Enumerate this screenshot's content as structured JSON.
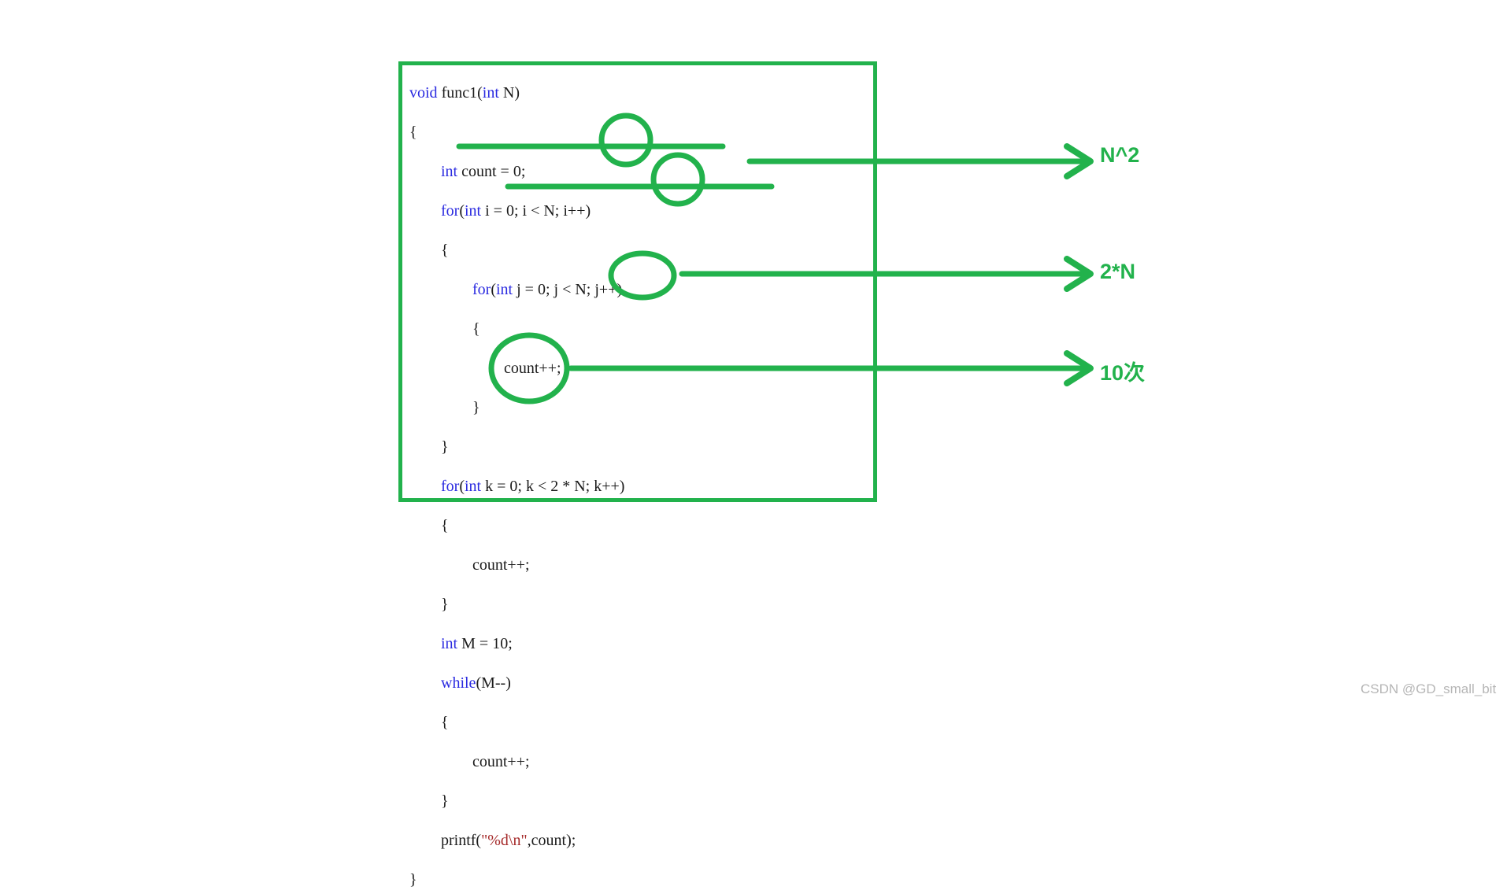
{
  "code": {
    "language": "c",
    "function_name": "func1",
    "lines": [
      [
        {
          "t": "void ",
          "c": "kw"
        },
        {
          "t": "func1(",
          "c": "pl"
        },
        {
          "t": "int",
          "c": "kw"
        },
        {
          "t": " N)",
          "c": "pl"
        }
      ],
      [
        {
          "t": "{",
          "c": "pl"
        }
      ],
      [
        {
          "t": "        ",
          "c": "pl"
        },
        {
          "t": "int",
          "c": "kw"
        },
        {
          "t": " count = 0;",
          "c": "pl"
        }
      ],
      [
        {
          "t": "        ",
          "c": "pl"
        },
        {
          "t": "for",
          "c": "kw"
        },
        {
          "t": "(",
          "c": "pl"
        },
        {
          "t": "int",
          "c": "kw"
        },
        {
          "t": " i = 0; i < N; i++)",
          "c": "pl"
        }
      ],
      [
        {
          "t": "        {",
          "c": "pl"
        }
      ],
      [
        {
          "t": "                ",
          "c": "pl"
        },
        {
          "t": "for",
          "c": "kw"
        },
        {
          "t": "(",
          "c": "pl"
        },
        {
          "t": "int",
          "c": "kw"
        },
        {
          "t": " j = 0; j < N; j++)",
          "c": "pl"
        }
      ],
      [
        {
          "t": "                {",
          "c": "pl"
        }
      ],
      [
        {
          "t": "                        count++;",
          "c": "pl"
        }
      ],
      [
        {
          "t": "                }",
          "c": "pl"
        }
      ],
      [
        {
          "t": "        }",
          "c": "pl"
        }
      ],
      [
        {
          "t": "        ",
          "c": "pl"
        },
        {
          "t": "for",
          "c": "kw"
        },
        {
          "t": "(",
          "c": "pl"
        },
        {
          "t": "int",
          "c": "kw"
        },
        {
          "t": " k = 0; k < 2 * N; k++)",
          "c": "pl"
        }
      ],
      [
        {
          "t": "        {",
          "c": "pl"
        }
      ],
      [
        {
          "t": "                count++;",
          "c": "pl"
        }
      ],
      [
        {
          "t": "        }",
          "c": "pl"
        }
      ],
      [
        {
          "t": "        ",
          "c": "pl"
        },
        {
          "t": "int",
          "c": "kw"
        },
        {
          "t": " M = 10;",
          "c": "pl"
        }
      ],
      [
        {
          "t": "        ",
          "c": "pl"
        },
        {
          "t": "while",
          "c": "kw"
        },
        {
          "t": "(M--)",
          "c": "pl"
        }
      ],
      [
        {
          "t": "        {",
          "c": "pl"
        }
      ],
      [
        {
          "t": "                count++;",
          "c": "pl"
        }
      ],
      [
        {
          "t": "        }",
          "c": "pl"
        }
      ],
      [
        {
          "t": "        printf(",
          "c": "pl"
        },
        {
          "t": "\"%d\\n\"",
          "c": "str"
        },
        {
          "t": ",count);",
          "c": "pl"
        }
      ],
      [
        {
          "t": "}",
          "c": "pl"
        }
      ]
    ]
  },
  "annotations": {
    "accent_color": "#22b24c",
    "labels": [
      {
        "id": "n2",
        "text": "N^2",
        "describes": "nested double for-loop over N"
      },
      {
        "id": "2n",
        "text": "2*N",
        "describes": "for-loop running 2 * N times"
      },
      {
        "id": "10ci",
        "text": "10次",
        "describes": "while loop running 10 times"
      }
    ],
    "marks": [
      {
        "kind": "circle",
        "target": "< N; (outer for condition)"
      },
      {
        "kind": "circle",
        "target": "< N; (inner for condition)"
      },
      {
        "kind": "ellipse",
        "target": "2 * N; (third for condition)"
      },
      {
        "kind": "circle",
        "target": "M = 10; / while(M--)"
      },
      {
        "kind": "underline",
        "target": "for(int i = 0; i < N; i++)"
      },
      {
        "kind": "underline",
        "target": "for(int j = 0; j < N; j++)"
      },
      {
        "kind": "arrow",
        "target": "N^2"
      },
      {
        "kind": "arrow",
        "target": "2*N"
      },
      {
        "kind": "arrow",
        "target": "10次"
      }
    ]
  },
  "watermark": {
    "text": "CSDN @GD_small_bit"
  }
}
